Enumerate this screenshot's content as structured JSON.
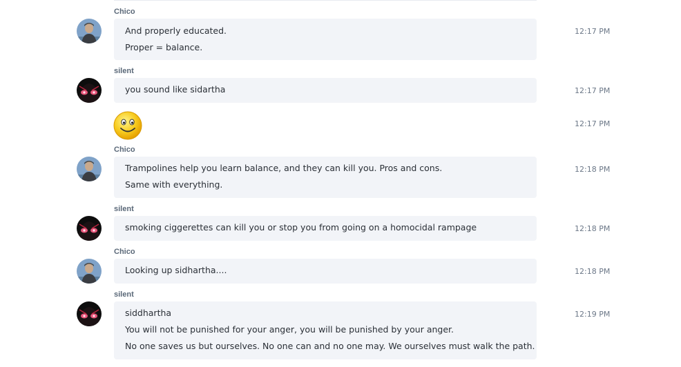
{
  "users": {
    "chico": "Chico",
    "silent": "silent"
  },
  "messages": [
    {
      "sender": "Chico",
      "lines": [
        "And properly educated.",
        "Proper = balance."
      ],
      "time": "12:17 PM"
    },
    {
      "sender": "silent",
      "lines": [
        "you sound like sidartha"
      ],
      "time": "12:17 PM"
    },
    {
      "sender": "silent",
      "emoticon": "smile-emoticon",
      "time": "12:17 PM"
    },
    {
      "sender": "Chico",
      "lines": [
        "Trampolines help you learn balance, and they can kill you.  Pros and cons.",
        "Same with everything."
      ],
      "time": "12:18 PM"
    },
    {
      "sender": "silent",
      "lines": [
        "smoking ciggerettes can kill you or stop you from going on a homocidal rampage"
      ],
      "time": "12:18 PM"
    },
    {
      "sender": "Chico",
      "lines": [
        "Looking up sidhartha...."
      ],
      "time": "12:18 PM"
    },
    {
      "sender": "silent",
      "lines": [
        "siddhartha",
        "You will not be punished for your anger, you will be punished by your anger.",
        "No one saves us but ourselves. No one can and no one may. We ourselves must walk the path."
      ],
      "time": "12:19 PM"
    }
  ],
  "colors": {
    "bubble": "#f2f4f8",
    "name": "#5a6878",
    "timestamp": "#6b7787"
  }
}
